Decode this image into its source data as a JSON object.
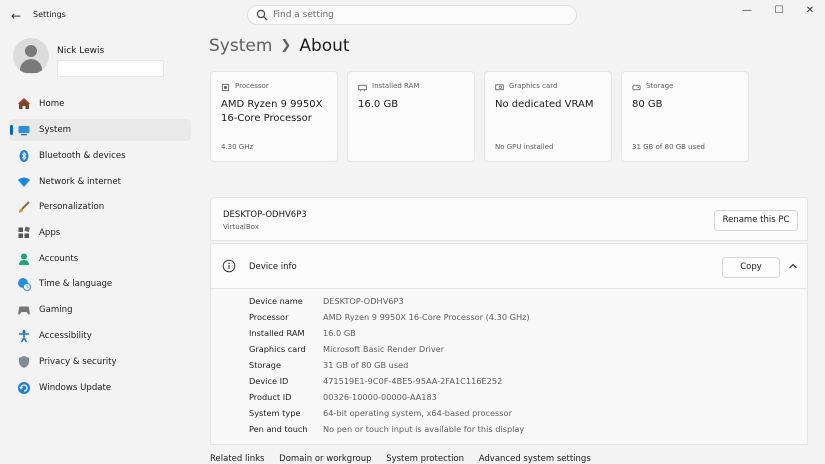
{
  "window": {
    "title": "Settings",
    "search_placeholder": "Find a setting",
    "controls": {
      "minimize": "—",
      "maximize": "☐",
      "close": "✕"
    }
  },
  "profile": {
    "name": "Nick Lewis"
  },
  "sidebar": {
    "items": [
      {
        "label": "Home",
        "icon": "home-icon"
      },
      {
        "label": "System",
        "icon": "system-icon",
        "active": true
      },
      {
        "label": "Bluetooth & devices",
        "icon": "bluetooth-icon"
      },
      {
        "label": "Network & internet",
        "icon": "wifi-icon"
      },
      {
        "label": "Personalization",
        "icon": "brush-icon"
      },
      {
        "label": "Apps",
        "icon": "apps-icon"
      },
      {
        "label": "Accounts",
        "icon": "accounts-icon"
      },
      {
        "label": "Time & language",
        "icon": "globe-clock-icon"
      },
      {
        "label": "Gaming",
        "icon": "gamepad-icon"
      },
      {
        "label": "Accessibility",
        "icon": "accessibility-icon"
      },
      {
        "label": "Privacy & security",
        "icon": "shield-icon"
      },
      {
        "label": "Windows Update",
        "icon": "update-icon"
      }
    ]
  },
  "header": {
    "parent": "System",
    "current": "About"
  },
  "cards": [
    {
      "label": "Processor",
      "value": "AMD Ryzen 9 9950X 16-Core Processor",
      "sub": "4.30 GHz",
      "icon": "processor-icon"
    },
    {
      "label": "Installed RAM",
      "value": "16.0 GB",
      "sub": "",
      "icon": "ram-icon"
    },
    {
      "label": "Graphics card",
      "value": "No dedicated VRAM",
      "sub": "No GPU installed",
      "icon": "graphics-card-icon"
    },
    {
      "label": "Storage",
      "value": "80 GB",
      "sub": "31 GB of 80 GB used",
      "icon": "storage-icon"
    }
  ],
  "device": {
    "name": "DESKTOP-ODHV6P3",
    "model": "VirtualBox",
    "rename_label": "Rename this PC"
  },
  "device_info": {
    "title": "Device info",
    "copy_label": "Copy",
    "specs": [
      {
        "label": "Device name",
        "value": "DESKTOP-ODHV6P3"
      },
      {
        "label": "Processor",
        "value": "AMD Ryzen 9 9950X 16-Core Processor (4.30 GHz)"
      },
      {
        "label": "Installed RAM",
        "value": "16.0 GB"
      },
      {
        "label": "Graphics card",
        "value": "Microsoft Basic Render Driver"
      },
      {
        "label": "Storage",
        "value": "31 GB of 80 GB used"
      },
      {
        "label": "Device ID",
        "value": "471519E1-9C0F-4BE5-95AA-2FA1C116E252"
      },
      {
        "label": "Product ID",
        "value": "00326-10000-00000-AA183"
      },
      {
        "label": "System type",
        "value": "64-bit operating system, x64-based processor"
      },
      {
        "label": "Pen and touch",
        "value": "No pen or touch input is available for this display"
      }
    ]
  },
  "related": {
    "label": "Related links",
    "links": [
      "Domain or workgroup",
      "System protection",
      "Advanced system settings"
    ]
  },
  "colors": {
    "accent": "#0067c0",
    "background": "#f3f3f3",
    "card": "#fbfbfb"
  }
}
